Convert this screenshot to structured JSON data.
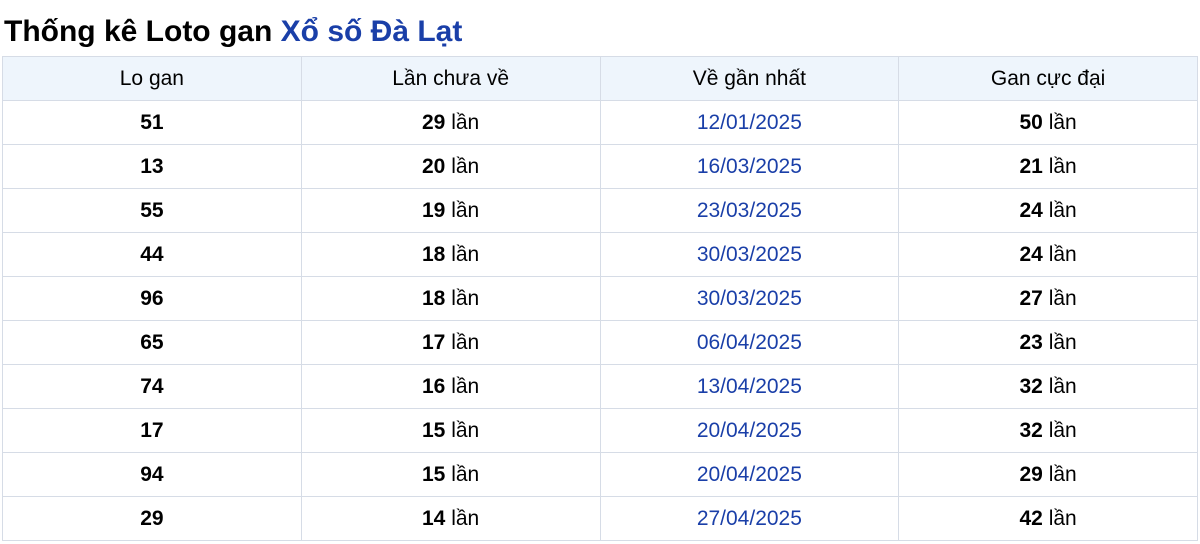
{
  "title": {
    "prefix": "Thống kê Loto gan",
    "link": "Xổ số Đà Lạt"
  },
  "table": {
    "headers": [
      "Lo gan",
      "Lần chưa về",
      "Về gần nhất",
      "Gan cực đại"
    ],
    "unit": "lần",
    "rows": [
      {
        "lo": "51",
        "miss": "29",
        "last": "12/01/2025",
        "max": "50"
      },
      {
        "lo": "13",
        "miss": "20",
        "last": "16/03/2025",
        "max": "21"
      },
      {
        "lo": "55",
        "miss": "19",
        "last": "23/03/2025",
        "max": "24"
      },
      {
        "lo": "44",
        "miss": "18",
        "last": "30/03/2025",
        "max": "24"
      },
      {
        "lo": "96",
        "miss": "18",
        "last": "30/03/2025",
        "max": "27"
      },
      {
        "lo": "65",
        "miss": "17",
        "last": "06/04/2025",
        "max": "23"
      },
      {
        "lo": "74",
        "miss": "16",
        "last": "13/04/2025",
        "max": "32"
      },
      {
        "lo": "17",
        "miss": "15",
        "last": "20/04/2025",
        "max": "32"
      },
      {
        "lo": "94",
        "miss": "15",
        "last": "20/04/2025",
        "max": "29"
      },
      {
        "lo": "29",
        "miss": "14",
        "last": "27/04/2025",
        "max": "42"
      }
    ]
  }
}
